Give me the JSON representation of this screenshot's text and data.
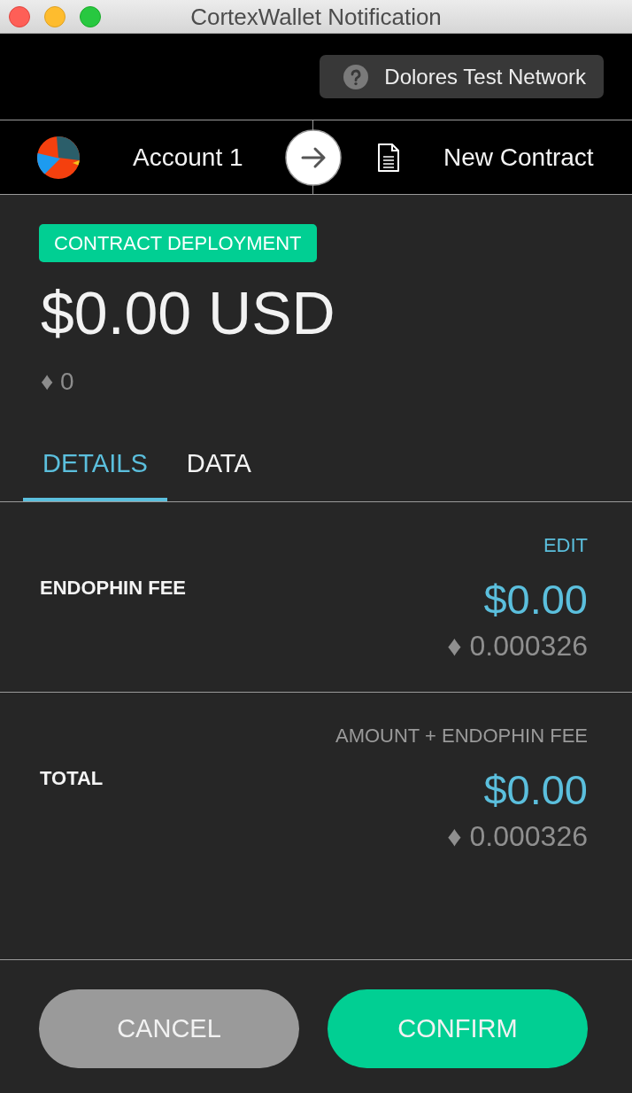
{
  "window": {
    "title": "CortexWallet Notification"
  },
  "network": {
    "label": "Dolores Test Network"
  },
  "transfer": {
    "from": "Account 1",
    "to": "New Contract"
  },
  "transaction": {
    "type": "CONTRACT DEPLOYMENT",
    "amount": "$0.00 USD",
    "amount_native": "♦ 0"
  },
  "tabs": [
    {
      "label": "DETAILS",
      "selected": true
    },
    {
      "label": "DATA",
      "selected": false
    }
  ],
  "details": [
    {
      "kind": "fee",
      "label": "ENDOPHIN FEE",
      "note": "EDIT",
      "usd": "$0.00",
      "native": "♦ 0.000326"
    },
    {
      "kind": "total",
      "label": "TOTAL",
      "note": "AMOUNT + ENDOPHIN FEE",
      "usd": "$0.00",
      "native": "♦ 0.000326"
    }
  ],
  "buttons": [
    {
      "label": "CANCEL",
      "kind": "secondary"
    },
    {
      "label": "CONFIRM",
      "kind": "primary"
    }
  ]
}
